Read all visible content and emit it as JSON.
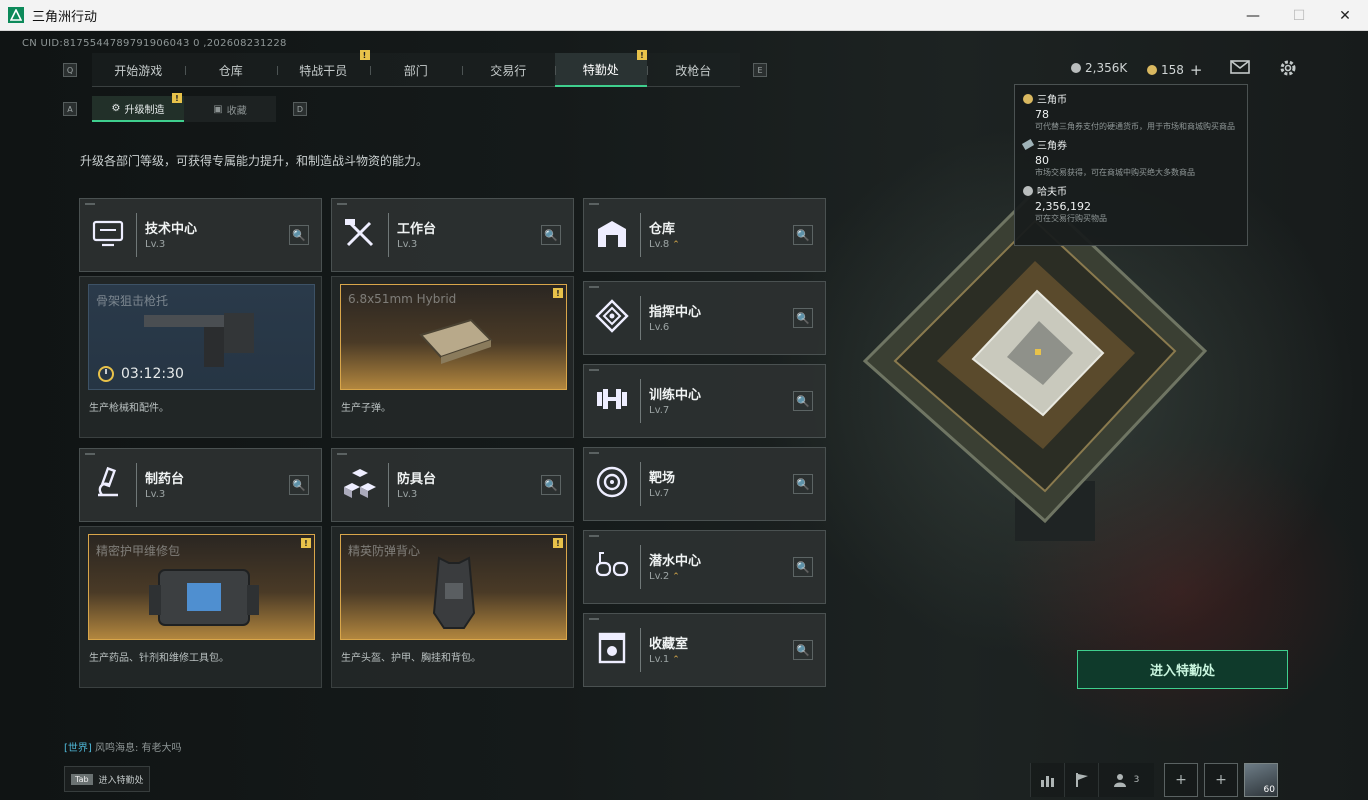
{
  "window": {
    "title": "三角洲行动",
    "controls": {
      "minimize": "—",
      "maximize": "☐",
      "close": "✕"
    }
  },
  "uid_text": "CN UID:8175544789791906043 0 ,202608231228",
  "nav": {
    "left_key": "Q",
    "right_key": "E",
    "tabs": [
      {
        "label": "开始游戏",
        "badge": false
      },
      {
        "label": "仓库",
        "badge": false
      },
      {
        "label": "特战干员",
        "badge": true
      },
      {
        "label": "部门",
        "badge": false
      },
      {
        "label": "交易行",
        "badge": false
      },
      {
        "label": "特勤处",
        "badge": true,
        "active": true
      },
      {
        "label": "改枪台",
        "badge": false
      }
    ]
  },
  "currency": {
    "silver_value": "2,356K",
    "gold_value": "158",
    "plus": "+"
  },
  "subnav": {
    "left_key": "A",
    "right_key": "D",
    "tabs": [
      {
        "label": "升级制造",
        "active": true,
        "badge": true
      },
      {
        "label": "收藏",
        "active": false
      }
    ]
  },
  "description": "升级各部门等级，可获得专属能力提升，和制造战斗物资的能力。",
  "badge_mark": "!",
  "search_glyph": "🔍",
  "workshops": [
    {
      "name": "技术中心",
      "level": "Lv.3",
      "icon": "tech-monitor-icon",
      "product_name": "骨架狙击枪托",
      "product_text": "生产枪械和配件。",
      "timer": "03:12:30",
      "style": "blue"
    },
    {
      "name": "工作台",
      "level": "Lv.3",
      "icon": "tools-icon",
      "product_name": "6.8x51mm Hybrid",
      "product_text": "生产子弹。",
      "style": "gold",
      "badge": true
    },
    {
      "name": "制药台",
      "level": "Lv.3",
      "icon": "microscope-icon",
      "product_name": "精密护甲维修包",
      "product_text": "生产药品、针剂和维修工具包。",
      "style": "gold",
      "badge": true
    },
    {
      "name": "防具台",
      "level": "Lv.3",
      "icon": "cubes-icon",
      "product_name": "精英防弹背心",
      "product_text": "生产头盔、护甲、胸挂和背包。",
      "style": "gold",
      "badge": true
    }
  ],
  "facilities": [
    {
      "name": "仓库",
      "level": "Lv.8",
      "upgradable": true,
      "icon": "warehouse-icon"
    },
    {
      "name": "指挥中心",
      "level": "Lv.6",
      "upgradable": false,
      "icon": "command-icon"
    },
    {
      "name": "训练中心",
      "level": "Lv.7",
      "upgradable": false,
      "icon": "dumbbell-icon"
    },
    {
      "name": "靶场",
      "level": "Lv.7",
      "upgradable": false,
      "icon": "target-icon"
    },
    {
      "name": "潜水中心",
      "level": "Lv.2",
      "upgradable": true,
      "icon": "dive-goggles-icon"
    },
    {
      "name": "收藏室",
      "level": "Lv.1",
      "upgradable": true,
      "icon": "collection-icon"
    }
  ],
  "upgrade_arrow": "⌃",
  "tooltip": {
    "items": [
      {
        "name": "三角币",
        "value": "78",
        "desc": "可代替三角券支付的硬通货币，用于市场和商城购买商品",
        "coin": "gold"
      },
      {
        "name": "三角券",
        "value": "80",
        "desc": "市场交易获得，可在商城中购买绝大多数商品",
        "coin": "ticket"
      },
      {
        "name": "哈夫币",
        "value": "2,356,192",
        "desc": "可在交易行购买物品",
        "coin": "silver"
      }
    ]
  },
  "enter_button": "进入特勤处",
  "chat": {
    "channel": "[世界]",
    "message": "风鸣海息: 有老大吗"
  },
  "tab_hint": {
    "key": "Tab",
    "label": "进入特勤处"
  },
  "bottom": {
    "friends_count": "3",
    "avatar_level": "60"
  },
  "colors": {
    "accent": "#3fcf8e",
    "badge": "#e8c24a",
    "gold_panel": "#b2863e"
  }
}
